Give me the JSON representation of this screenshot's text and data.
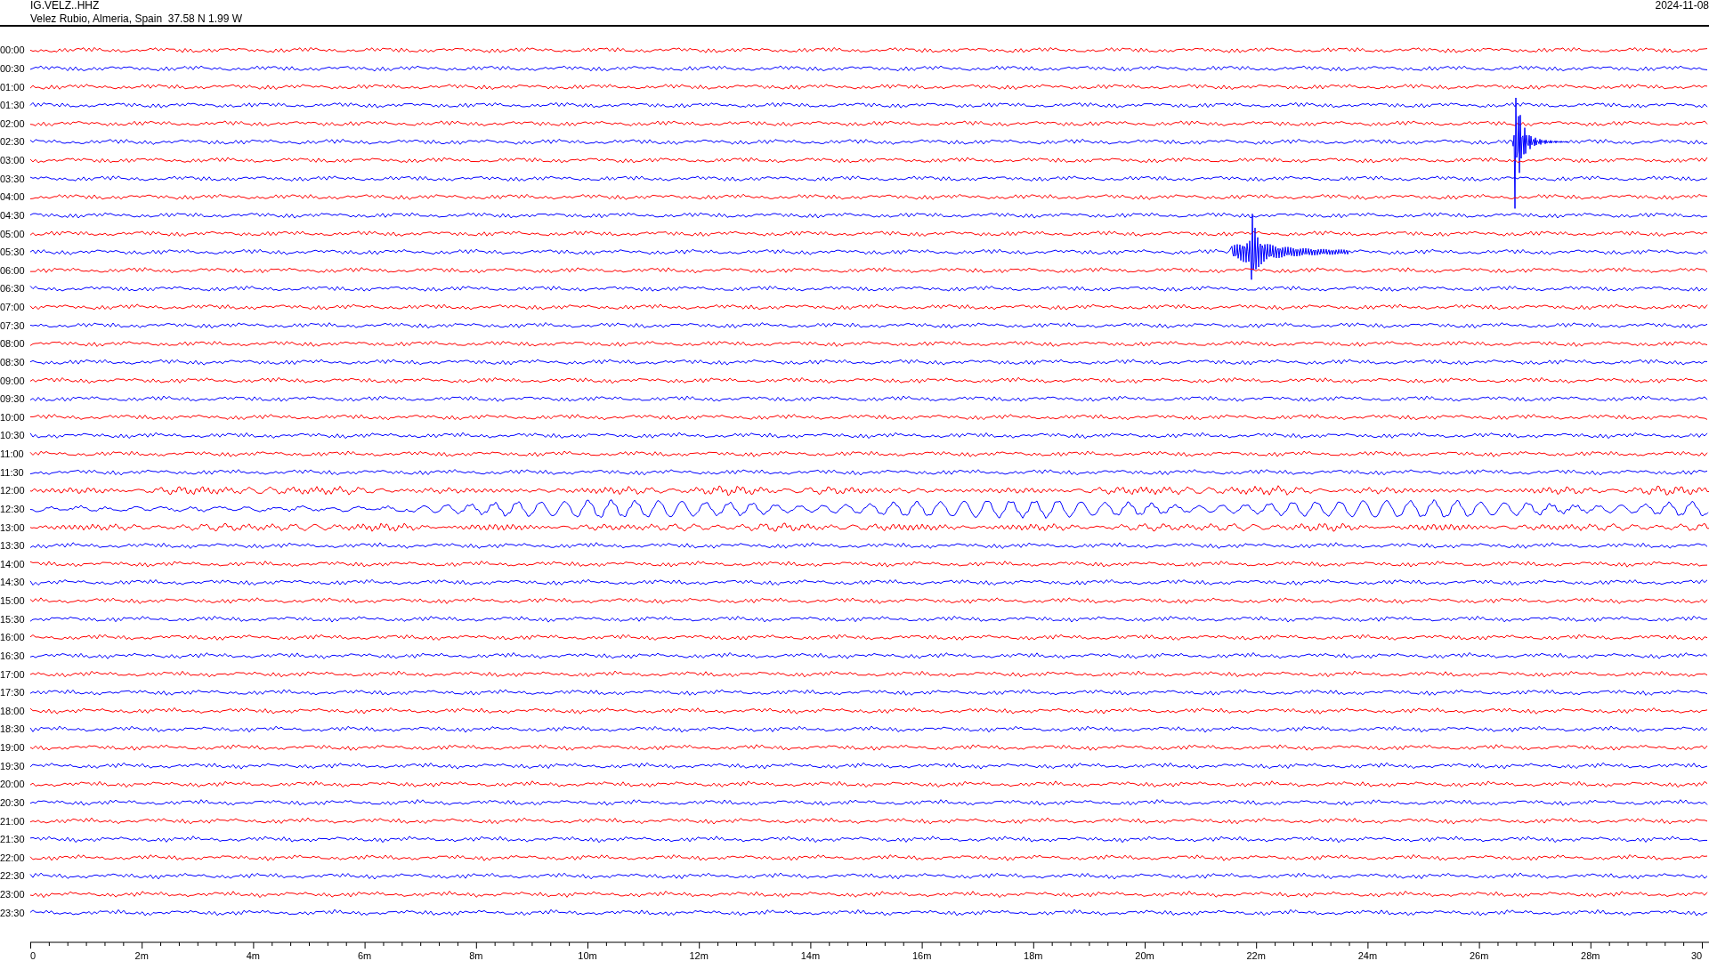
{
  "header": {
    "station": "IG.VELZ..HHZ",
    "location": "Velez Rubio, Almeria, Spain  37.58 N 1.99 W",
    "date": "2024-11-08"
  },
  "rows": [
    {
      "time": "00:00",
      "color": "#ff0000",
      "kind": "quiet"
    },
    {
      "time": "00:30",
      "color": "#0000ff",
      "kind": "quiet"
    },
    {
      "time": "01:00",
      "color": "#ff0000",
      "kind": "quiet"
    },
    {
      "time": "01:30",
      "color": "#0000ff",
      "kind": "quiet"
    },
    {
      "time": "02:00",
      "color": "#ff0000",
      "kind": "quiet"
    },
    {
      "time": "02:30",
      "color": "#0000ff",
      "kind": "spike"
    },
    {
      "time": "03:00",
      "color": "#ff0000",
      "kind": "quiet"
    },
    {
      "time": "03:30",
      "color": "#0000ff",
      "kind": "quiet"
    },
    {
      "time": "04:00",
      "color": "#ff0000",
      "kind": "quiet"
    },
    {
      "time": "04:30",
      "color": "#0000ff",
      "kind": "quiet"
    },
    {
      "time": "05:00",
      "color": "#ff0000",
      "kind": "quiet"
    },
    {
      "time": "05:30",
      "color": "#0000ff",
      "kind": "burst"
    },
    {
      "time": "06:00",
      "color": "#ff0000",
      "kind": "quiet"
    },
    {
      "time": "06:30",
      "color": "#0000ff",
      "kind": "quiet"
    },
    {
      "time": "07:00",
      "color": "#ff0000",
      "kind": "quiet"
    },
    {
      "time": "07:30",
      "color": "#0000ff",
      "kind": "quiet"
    },
    {
      "time": "08:00",
      "color": "#ff0000",
      "kind": "quiet"
    },
    {
      "time": "08:30",
      "color": "#0000ff",
      "kind": "quiet"
    },
    {
      "time": "09:00",
      "color": "#ff0000",
      "kind": "quiet"
    },
    {
      "time": "09:30",
      "color": "#0000ff",
      "kind": "quiet"
    },
    {
      "time": "10:00",
      "color": "#ff0000",
      "kind": "quiet"
    },
    {
      "time": "10:30",
      "color": "#0000ff",
      "kind": "quiet"
    },
    {
      "time": "11:00",
      "color": "#ff0000",
      "kind": "quiet"
    },
    {
      "time": "11:30",
      "color": "#0000ff",
      "kind": "quiet"
    },
    {
      "time": "12:00",
      "color": "#ff0000",
      "kind": "wavy"
    },
    {
      "time": "12:30",
      "color": "#0000ff",
      "kind": "swell"
    },
    {
      "time": "13:00",
      "color": "#ff0000",
      "kind": "wavy"
    },
    {
      "time": "13:30",
      "color": "#0000ff",
      "kind": "quiet"
    },
    {
      "time": "14:00",
      "color": "#ff0000",
      "kind": "quiet"
    },
    {
      "time": "14:30",
      "color": "#0000ff",
      "kind": "quiet"
    },
    {
      "time": "15:00",
      "color": "#ff0000",
      "kind": "quiet"
    },
    {
      "time": "15:30",
      "color": "#0000ff",
      "kind": "quiet"
    },
    {
      "time": "16:00",
      "color": "#ff0000",
      "kind": "quiet"
    },
    {
      "time": "16:30",
      "color": "#0000ff",
      "kind": "quiet"
    },
    {
      "time": "17:00",
      "color": "#ff0000",
      "kind": "quiet"
    },
    {
      "time": "17:30",
      "color": "#0000ff",
      "kind": "quiet"
    },
    {
      "time": "18:00",
      "color": "#ff0000",
      "kind": "quiet"
    },
    {
      "time": "18:30",
      "color": "#0000ff",
      "kind": "quiet"
    },
    {
      "time": "19:00",
      "color": "#ff0000",
      "kind": "quiet"
    },
    {
      "time": "19:30",
      "color": "#0000ff",
      "kind": "quiet"
    },
    {
      "time": "20:00",
      "color": "#ff0000",
      "kind": "quiet"
    },
    {
      "time": "20:30",
      "color": "#0000ff",
      "kind": "quiet"
    },
    {
      "time": "21:00",
      "color": "#ff0000",
      "kind": "quiet"
    },
    {
      "time": "21:30",
      "color": "#0000ff",
      "kind": "quiet"
    },
    {
      "time": "22:00",
      "color": "#ff0000",
      "kind": "quiet"
    },
    {
      "time": "22:30",
      "color": "#0000ff",
      "kind": "quiet"
    },
    {
      "time": "23:00",
      "color": "#ff0000",
      "kind": "quiet"
    },
    {
      "time": "23:30",
      "color": "#0000ff",
      "kind": "quiet"
    }
  ],
  "axis": {
    "labels": [
      "0",
      "2m",
      "4m",
      "6m",
      "8m",
      "10m",
      "12m",
      "14m",
      "16m",
      "18m",
      "20m",
      "22m",
      "24m",
      "26m",
      "28m",
      "30"
    ]
  }
}
